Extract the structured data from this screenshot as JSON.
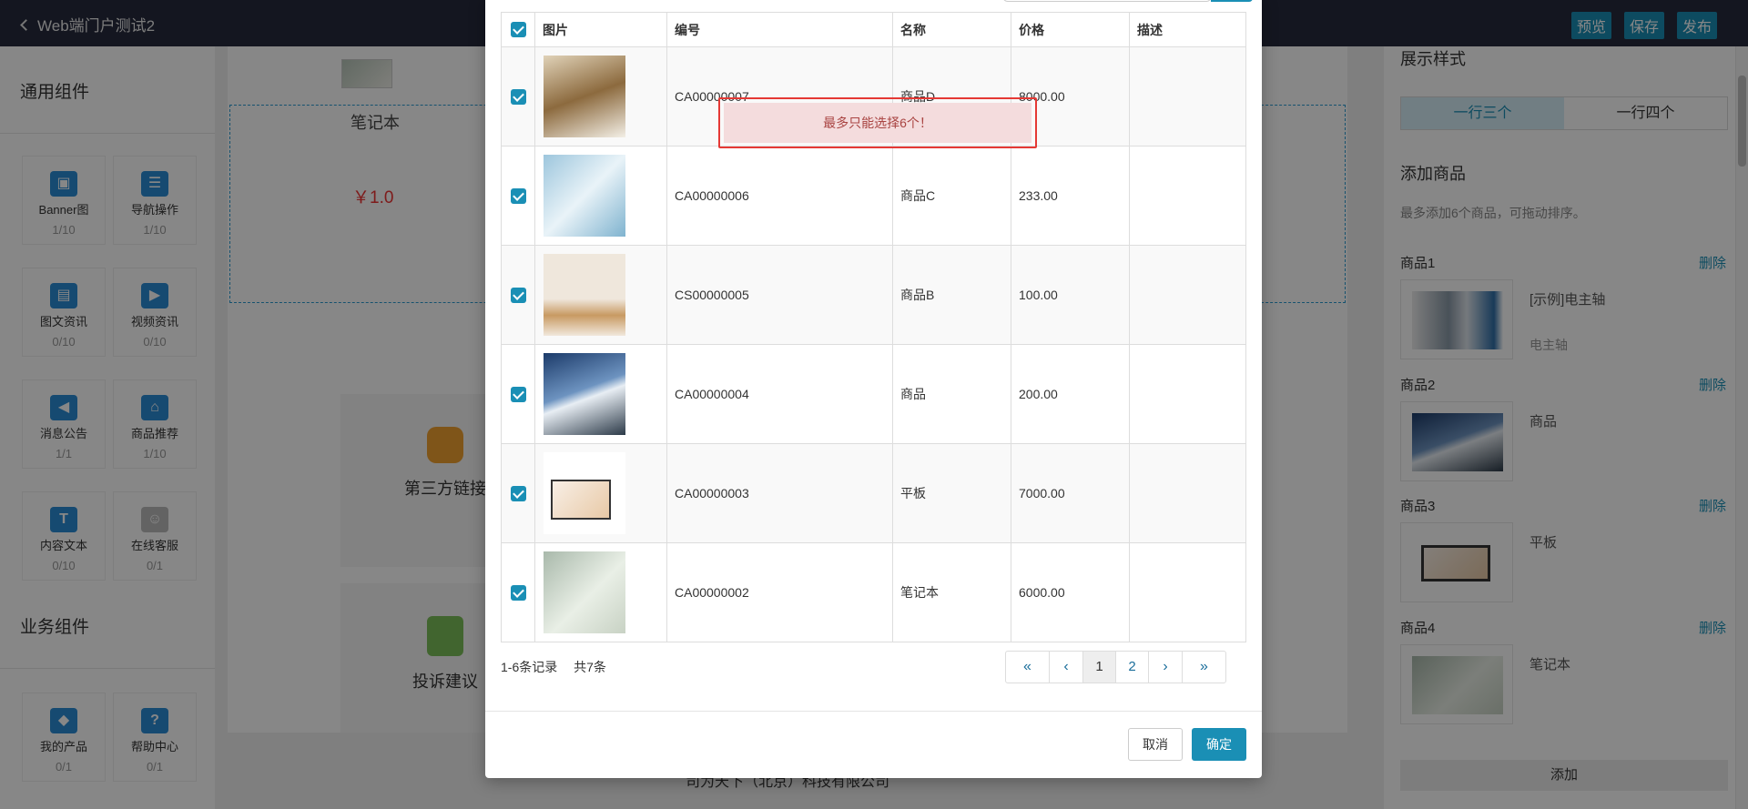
{
  "header": {
    "back_label": "Web端门户测试2",
    "preview": "预览",
    "save": "保存",
    "publish": "发布"
  },
  "left": {
    "general_title": "通用组件",
    "business_title": "业务组件",
    "components": [
      {
        "label": "Banner图",
        "count": "1/10"
      },
      {
        "label": "导航操作",
        "count": "1/10"
      },
      {
        "label": "图文资讯",
        "count": "0/10"
      },
      {
        "label": "视频资讯",
        "count": "0/10"
      },
      {
        "label": "消息公告",
        "count": "1/1"
      },
      {
        "label": "商品推荐",
        "count": "1/10"
      },
      {
        "label": "内容文本",
        "count": "0/10"
      },
      {
        "label": "在线客服",
        "count": "0/1"
      }
    ],
    "business": [
      {
        "label": "我的产品",
        "count": "0/1"
      },
      {
        "label": "帮助中心",
        "count": "0/1"
      }
    ]
  },
  "canvas": {
    "product_name": "笔记本",
    "product_price": "￥1.0",
    "tile1": "第三方链接",
    "tile2": "投诉建议",
    "footer": "司为天下（北京）科技有限公司"
  },
  "right": {
    "display_title": "展示样式",
    "seg": [
      "一行三个",
      "一行四个"
    ],
    "add_title": "添加商品",
    "hint": "最多添加6个商品，可拖动排序。",
    "delete": "删除",
    "goods": [
      {
        "label": "商品1",
        "name": "[示例]电主轴",
        "sub": "电主轴"
      },
      {
        "label": "商品2",
        "name": "商品",
        "sub": ""
      },
      {
        "label": "商品3",
        "name": "平板",
        "sub": ""
      },
      {
        "label": "商品4",
        "name": "笔记本",
        "sub": ""
      }
    ],
    "add_button": "添加"
  },
  "modal": {
    "columns": [
      "图片",
      "编号",
      "名称",
      "价格",
      "描述"
    ],
    "rows": [
      {
        "code": "CA00000007",
        "name": "商品D",
        "price": "8000.00",
        "desc": ""
      },
      {
        "code": "CA00000006",
        "name": "商品C",
        "price": "233.00",
        "desc": ""
      },
      {
        "code": "CS00000005",
        "name": "商品B",
        "price": "100.00",
        "desc": ""
      },
      {
        "code": "CA00000004",
        "name": "商品",
        "price": "200.00",
        "desc": ""
      },
      {
        "code": "CA00000003",
        "name": "平板",
        "price": "7000.00",
        "desc": ""
      },
      {
        "code": "CA00000002",
        "name": "笔记本",
        "price": "6000.00",
        "desc": ""
      }
    ],
    "alert": "最多只能选择6个！",
    "range_text": "1-6条记录",
    "total_text": "共7条",
    "pager": {
      "first": "«",
      "prev": "‹",
      "p1": "1",
      "p2": "2",
      "next": "›",
      "last": "»"
    },
    "cancel": "取消",
    "ok": "确定"
  }
}
